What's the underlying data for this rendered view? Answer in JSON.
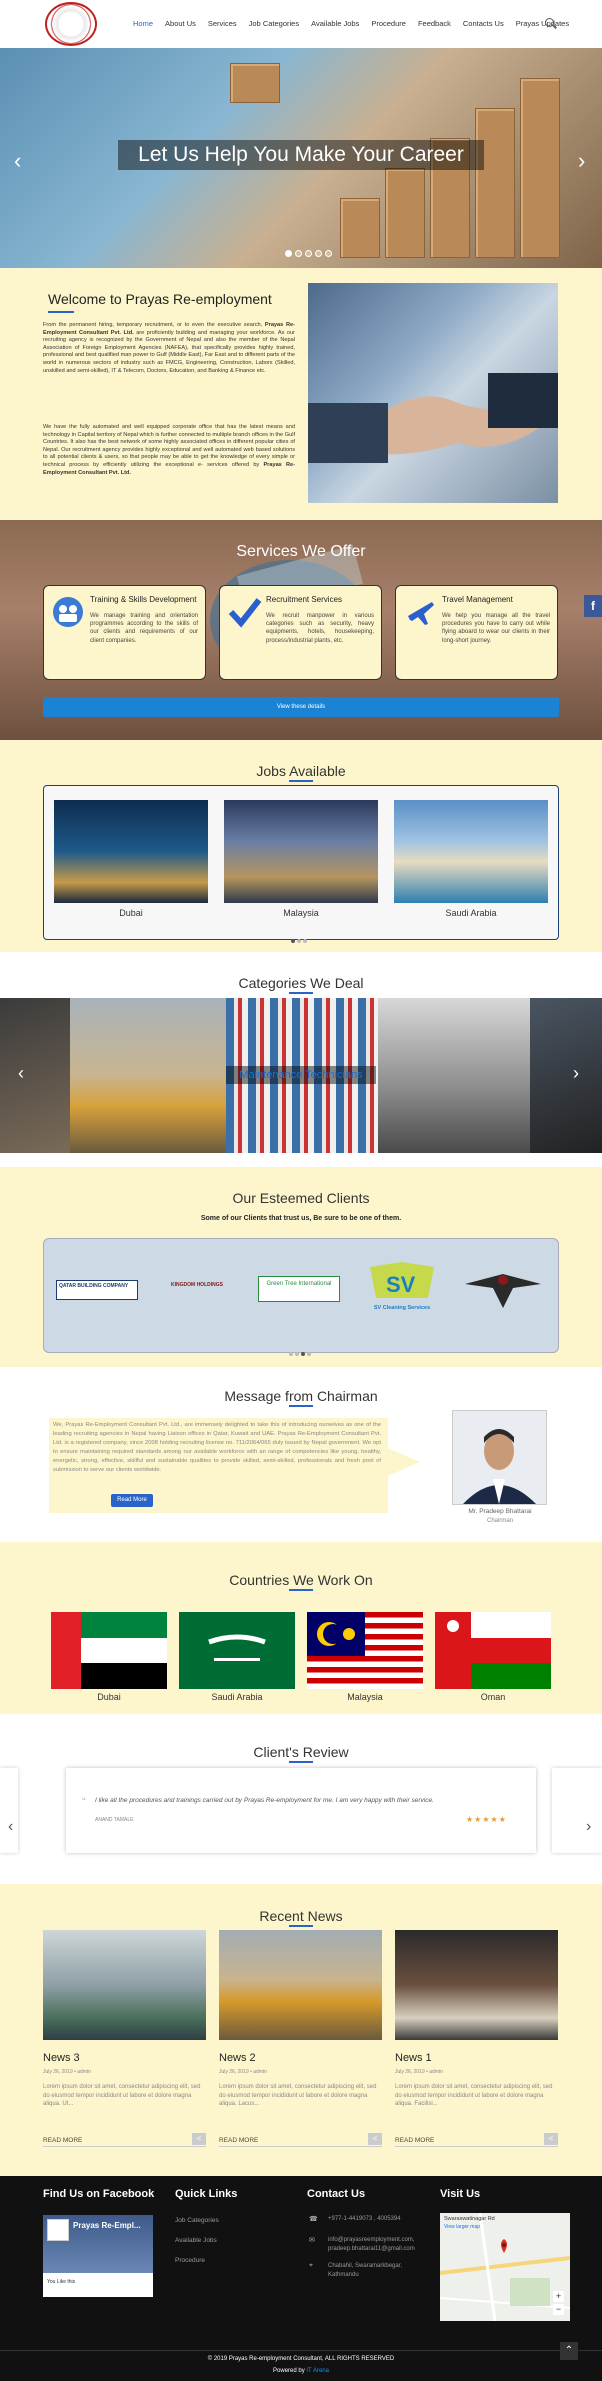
{
  "nav": {
    "items": [
      "Home",
      "About Us",
      "Services",
      "Job Categories",
      "Available Jobs",
      "Procedure",
      "Feedback",
      "Contacts Us",
      "Prayas Updates"
    ],
    "active": "Home"
  },
  "hero": {
    "caption": "Let Us Help You Make Your Career",
    "prev": "‹",
    "next": "›"
  },
  "welcome": {
    "title": "Welcome to Prayas Re-employment",
    "p1_a": "From the permanent hiring, temporary recruitment, or to even the executive search, ",
    "p1_b": "Prayas Re-Employment Consultant Pvt. Ltd.",
    "p1_c": " are proficiently building and managing your workforce. As our recruiting agency is recognized by the Government of Nepal and also the member of the Nepal Association of Foreign Employment Agencies (NAFEA), that specifically provides highly trained, professional and best qualified man power to Gulf (Middle East), Far East and to different parts of the world in numerous sectors of industry such as FMCG, Engineering, Construction, Labors (Skilled, unskilled and semi-skilled), IT & Telecom, Doctors, Education, and Banking & Finance etc.",
    "p2_a": "We have the fully automated and well equipped corporate office that has the latest means and technology in Capital territory of Nepal which is further connected to multiple branch offices in the Gulf Countries. It also has the best network of some highly associated offices in different popular cities of Nepal. Our recruitment agency provides highly exceptional and well automated web based solutions to all potential clients & users, so that people may be able to get the knowledge of every simple or technical process by efficiently utilizing the exceptional e- services offered by ",
    "p2_b": "Prayas Re-Employment Consultant Pvt. Ltd."
  },
  "services": {
    "title": "Services We Offer",
    "cards": [
      {
        "title": "Training & Skills Development",
        "desc": "We manage training and orientation programmes according to the skills of our clients and requirements of our client companies."
      },
      {
        "title": "Recruitment Services",
        "desc": "We recruit manpower in various categories such as security, heavy equipments, hotels, housekeeping, process/industrial plants, etc."
      },
      {
        "title": "Travel Management",
        "desc": "We help you manage all the travel procedures you have to carry out while flying aboard to wear our clients in their long-short journey."
      }
    ],
    "button": "View these details",
    "fb_tab": "f"
  },
  "jobs": {
    "title": "Jobs Available",
    "items": [
      {
        "label": "Dubai"
      },
      {
        "label": "Malaysia"
      },
      {
        "label": "Saudi Arabia"
      }
    ]
  },
  "categories": {
    "title": "Categories We Deal",
    "current": "Maintenance Technicians"
  },
  "clients": {
    "title": "Our Esteemed Clients",
    "subtitle": "Some of our Clients that trust us, Be sure to be one of them.",
    "logos": [
      "QATAR BUILDING COMPANY",
      "KINGDOM HOLDINGS",
      "Green Tree International",
      "SV Cleaning Services",
      "Eagle"
    ]
  },
  "chairman": {
    "title": "Message from Chairman",
    "message": "We, Prayas Re-Employment Consultant Pvt. Ltd., are immensely delighted to take this of introducing ourselves as one of the leading recruiting agencies in Nepal having Liaison offices in Qatar, Kuwait and UAE. Prayas Re-Employment Consultant Pvt. Ltd. is a registered company, since 2008 holding recruiting license no. 711/2064/065 duly issued by Nepal government. We opt to ensure maintaining required standards among our available workforce with an range of competencies like young, healthy, energetic, strong, effective, skillful and sustainable qualities to provide skilled, semi-skilled, professionals and fresh pool of submission to serve our clients worldwide.",
    "read_more": "Read More",
    "name": "Mr. Pradeep Bhattarai",
    "role": "Chairman"
  },
  "countries": {
    "title": "Countries We Work On",
    "items": [
      {
        "label": "Dubai"
      },
      {
        "label": "Saudi Arabia"
      },
      {
        "label": "Malaysia"
      },
      {
        "label": "Oman"
      }
    ]
  },
  "review": {
    "title": "Client's Review",
    "text": "I like all the procedures and trainings carried out by Prayas Re-employment for me. I am very happy with their service.",
    "author": "ANAND TAMALE",
    "stars": "★★★★★"
  },
  "news": {
    "title": "Recent News",
    "items": [
      {
        "title": "News 3",
        "meta": "July 26, 2019 • admin",
        "text": "Lorem ipsum dolor sit amet, consectetur adipiscing elit, sed do eiusmod tempor incididunt ut labore et dolore magna aliqua. Ut...",
        "more": "READ MORE"
      },
      {
        "title": "News 2",
        "meta": "July 26, 2019 • admin",
        "text": "Lorem ipsum dolor sit amet, consectetur adipiscing elit, sed do eiusmod tempor incididunt ut labore et dolore magna aliqua. Lacus...",
        "more": "READ MORE"
      },
      {
        "title": "News 1",
        "meta": "July 26, 2019 • admin",
        "text": "Lorem ipsum dolor sit amet, consectetur adipiscing elit, sed do eiusmod tempor incididunt ut labore et dolore magna aliqua. Facilisi...",
        "more": "READ MORE"
      }
    ]
  },
  "footer": {
    "facebook_title": "Find Us on Facebook",
    "fb_page": "Prayas Re-Empl...",
    "fb_likes": "You Like this",
    "quick_title": "Quick Links",
    "quick_links": [
      "Job Categories",
      "Available Jobs",
      "Procedure"
    ],
    "contact_title": "Contact Us",
    "phone": "+977-1-4419073 , 4005394",
    "email": "info@prayasreemployment.com, pradeep.bhattarai11@gmail.com",
    "address": "Chabahil, Swaramarkbegar, Kathmandu",
    "visit_title": "Visit Us",
    "map_label": "Swaraswatinagar Rd",
    "map_link": "View larger map",
    "copyright": "© 2019 Prayas Re-employment Consultant, ALL RIGHTS RESERVED",
    "powered_prefix": "Powered by",
    "powered_name": "IT Arena"
  },
  "colors": {
    "accent": "#2a64c9",
    "cream": "#fdf6cc",
    "footer": "#111111"
  }
}
